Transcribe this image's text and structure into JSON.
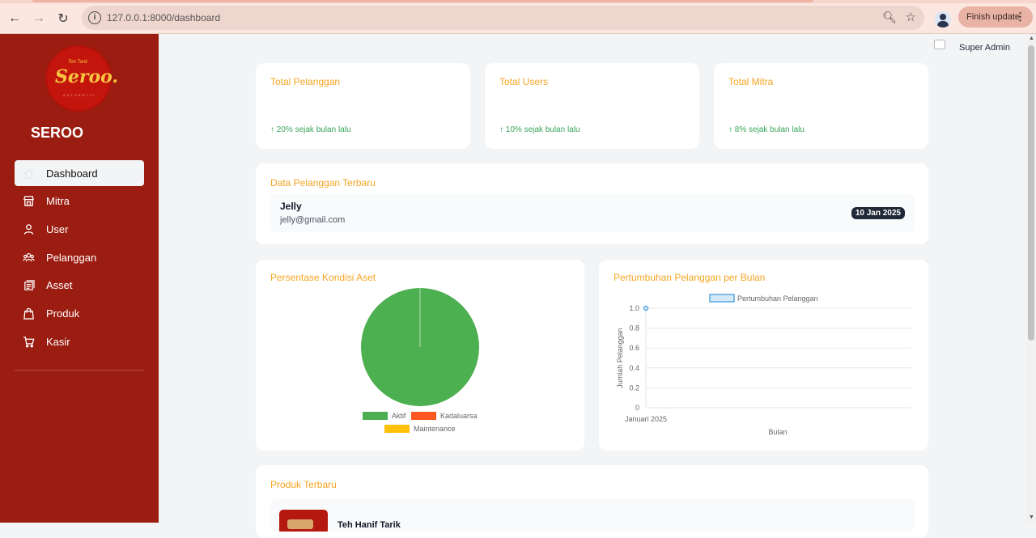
{
  "browser": {
    "url": "127.0.0.1:8000/dashboard",
    "finish_update": "Finish update"
  },
  "sidebar": {
    "logo_small": "Teh Tarik",
    "logo_brand": "Seroo.",
    "logo_sub": "AUTHENTIC",
    "app_name": "SEROO",
    "items": [
      {
        "label": "Dashboard",
        "icon": "home-icon",
        "active": true
      },
      {
        "label": "Mitra",
        "icon": "store-icon"
      },
      {
        "label": "User",
        "icon": "user-icon"
      },
      {
        "label": "Pelanggan",
        "icon": "users-icon"
      },
      {
        "label": "Asset",
        "icon": "asset-icon"
      },
      {
        "label": "Produk",
        "icon": "bag-icon"
      },
      {
        "label": "Kasir",
        "icon": "cart-icon"
      }
    ]
  },
  "header": {
    "user_name": "Super Admin"
  },
  "stats": [
    {
      "title": "Total Pelanggan",
      "growth": "↑ 20% sejak bulan lalu"
    },
    {
      "title": "Total Users",
      "growth": "↑ 10% sejak bulan lalu"
    },
    {
      "title": "Total Mitra",
      "growth": "↑ 8% sejak bulan lalu"
    }
  ],
  "recent_customers": {
    "title": "Data Pelanggan Terbaru",
    "rows": [
      {
        "name": "Jelly",
        "email": "jelly@gmail.com",
        "date": "10 Jan 2025"
      }
    ]
  },
  "asset_chart": {
    "title": "Persentase Kondisi Aset"
  },
  "growth_chart": {
    "title": "Pertumbuhan Pelanggan per Bulan"
  },
  "products": {
    "title": "Produk Terbaru",
    "first_name": "Teh Hanif Tarik"
  },
  "colors": {
    "sidebar": "#9b1c10",
    "accent": "#f5a524",
    "success": "#3aa55a",
    "aktif": "#4caf50",
    "kadaluarsa": "#ff5722",
    "maintenance": "#ffc107"
  },
  "chart_data": [
    {
      "type": "pie",
      "title": "",
      "categories": [
        "Aktif",
        "Kadaluarsa",
        "Maintenance"
      ],
      "values": [
        1,
        0,
        0
      ],
      "legend": "bottom"
    },
    {
      "type": "line",
      "title": "",
      "x": [
        "Januari 2025"
      ],
      "series": [
        {
          "name": "Pertumbuhan Pelanggan",
          "values": [
            1.0
          ]
        }
      ],
      "xlabel": "Bulan",
      "ylabel": "Jumlah Pelanggan",
      "ylim": [
        0,
        1.0
      ],
      "yticks": [
        "0",
        "0.2",
        "0.4",
        "0.6",
        "0.8",
        "1.0"
      ],
      "grid": true,
      "legend": "top"
    }
  ]
}
